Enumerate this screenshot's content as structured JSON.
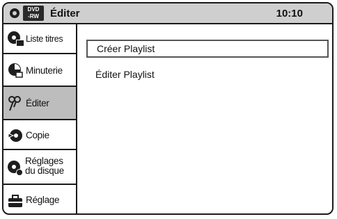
{
  "header": {
    "disc_icon": "disc-icon",
    "media_badge": {
      "line1": "DVD",
      "line2": "-RW"
    },
    "title": "Éditer",
    "time": "10:10"
  },
  "menu": {
    "items": [
      {
        "label": "Liste titres",
        "icon": "title-list-icon",
        "active": false
      },
      {
        "label": "Minuterie",
        "icon": "timer-icon",
        "active": false
      },
      {
        "label": "Éditer",
        "icon": "scissors-icon",
        "active": true
      },
      {
        "label": "Copie",
        "icon": "copy-disc-icon",
        "active": false
      },
      {
        "label_line1": "Réglages",
        "label_line2": "du disque",
        "icon": "disc-settings-icon",
        "active": false
      },
      {
        "label": "Réglage",
        "icon": "toolbox-icon",
        "active": false
      }
    ]
  },
  "content": {
    "options": [
      {
        "label": "Créer Playlist",
        "selected": true
      },
      {
        "label": "Éditer Playlist",
        "selected": false
      }
    ]
  }
}
